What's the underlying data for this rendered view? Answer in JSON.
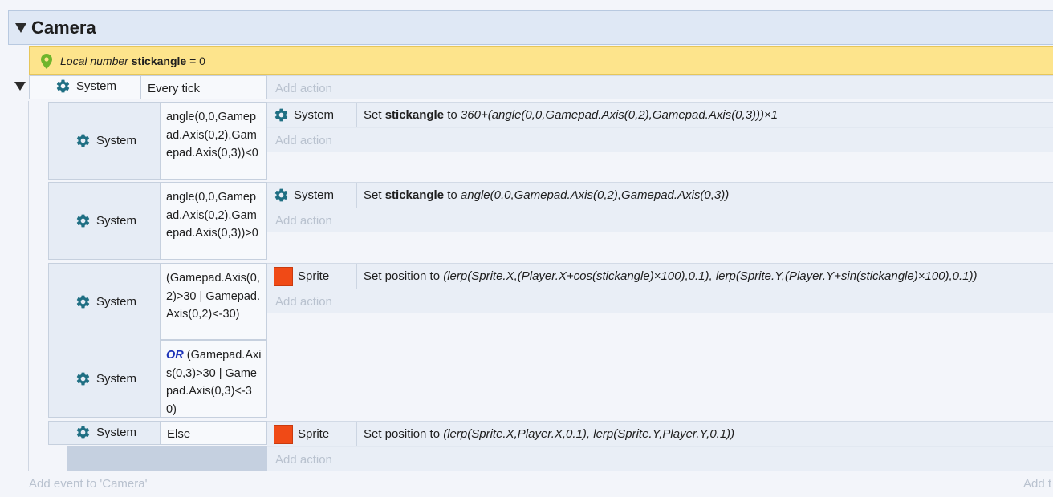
{
  "group": {
    "title": "Camera"
  },
  "local_var": {
    "prefix": "Local number",
    "name": "stickangle",
    "suffix": "= 0"
  },
  "event_main": {
    "object": "System",
    "condition": "Every tick",
    "add_action": "Add action"
  },
  "sub1": {
    "object": "System",
    "condition": "angle(0,0,Gamepad.Axis(0,2),Gamepad.Axis(0,3))<0",
    "action_object": "System",
    "action_set": "Set",
    "action_var": "stickangle",
    "action_to": "to",
    "action_expr": "360+(angle(0,0,Gamepad.Axis(0,2),Gamepad.Axis(0,3)))×1",
    "add_action": "Add action"
  },
  "sub2": {
    "object": "System",
    "condition": "angle(0,0,Gamepad.Axis(0,2),Gamepad.Axis(0,3))>0",
    "action_object": "System",
    "action_set": "Set",
    "action_var": "stickangle",
    "action_to": "to",
    "action_expr": "angle(0,0,Gamepad.Axis(0,2),Gamepad.Axis(0,3))",
    "add_action": "Add action"
  },
  "sub3": {
    "object1": "System",
    "condition1": "(Gamepad.Axis(0,2)>30 | Gamepad.Axis(0,2)<-30)",
    "object2": "System",
    "or_label": "OR",
    "condition2": "(Gamepad.Axis(0,3)>30 | Gamepad.Axis(0,3)<-30)",
    "action_object": "Sprite",
    "action_prefix": "Set position to",
    "action_expr": "(lerp(Sprite.X,(Player.X+cos(stickangle)×100),0.1), lerp(Sprite.Y,(Player.Y+sin(stickangle)×100),0.1))",
    "add_action": "Add action"
  },
  "sub4": {
    "object": "System",
    "condition": "Else",
    "action_object": "Sprite",
    "action_prefix": "Set position to",
    "action_expr": "(lerp(Sprite.X,Player.X,0.1), lerp(Sprite.Y,Player.Y,0.1))",
    "add_action": "Add action"
  },
  "footer": {
    "add_event": "Add event to 'Camera'",
    "add_right": "Add t"
  },
  "icons": {
    "gear": "gear-icon",
    "pin": "location-pin-icon",
    "sprite": "sprite-icon"
  },
  "colors": {
    "gear": "#1f6f83",
    "sprite": "#f04a16",
    "local_var_bg": "#fde48c",
    "or": "#1c33b8"
  }
}
